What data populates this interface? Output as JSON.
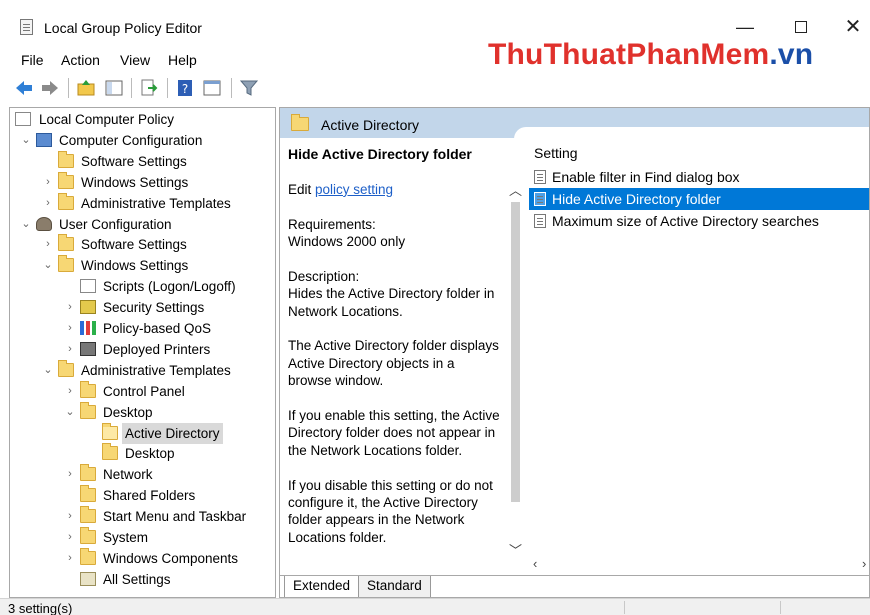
{
  "window": {
    "title": "Local Group Policy Editor",
    "min": "—",
    "close": "✕"
  },
  "watermark": {
    "part1": "ThuThuat",
    "part2": "PhanMem",
    "part3": ".vn"
  },
  "menu": [
    "File",
    "Action",
    "View",
    "Help"
  ],
  "toolbar": [
    "back-icon",
    "forward-icon",
    "up-folder-icon",
    "show-hide-tree-icon",
    "export-list-icon",
    "help-icon",
    "properties-icon",
    "filter-icon"
  ],
  "tree": [
    {
      "label": "Local Computer Policy",
      "level": 0,
      "chev": "",
      "icon": "doc"
    },
    {
      "label": "Computer Configuration",
      "level": 1,
      "chev": "⌄",
      "icon": "computer"
    },
    {
      "label": "Software Settings",
      "level": 2,
      "chev": "",
      "icon": "folder"
    },
    {
      "label": "Windows Settings",
      "level": 2,
      "chev": "›",
      "icon": "folder"
    },
    {
      "label": "Administrative Templates",
      "level": 2,
      "chev": "›",
      "icon": "folder"
    },
    {
      "label": "User Configuration",
      "level": 1,
      "chev": "⌄",
      "icon": "user"
    },
    {
      "label": "Software Settings",
      "level": 2,
      "chev": "›",
      "icon": "folder"
    },
    {
      "label": "Windows Settings",
      "level": 2,
      "chev": "⌄",
      "icon": "folder"
    },
    {
      "label": "Scripts (Logon/Logoff)",
      "level": 3,
      "chev": "",
      "icon": "doc"
    },
    {
      "label": "Security Settings",
      "level": 3,
      "chev": "›",
      "icon": "shield"
    },
    {
      "label": "Policy-based QoS",
      "level": 3,
      "chev": "›",
      "icon": "bars"
    },
    {
      "label": "Deployed Printers",
      "level": 3,
      "chev": "›",
      "icon": "printer"
    },
    {
      "label": "Administrative Templates",
      "level": 2,
      "chev": "⌄",
      "icon": "folder"
    },
    {
      "label": "Control Panel",
      "level": 3,
      "chev": "›",
      "icon": "folder"
    },
    {
      "label": "Desktop",
      "level": 3,
      "chev": "⌄",
      "icon": "folder"
    },
    {
      "label": "Active Directory",
      "level": 4,
      "chev": "",
      "icon": "folder-open",
      "selected": true
    },
    {
      "label": "Desktop",
      "level": 4,
      "chev": "",
      "icon": "folder"
    },
    {
      "label": "Network",
      "level": 3,
      "chev": "›",
      "icon": "folder"
    },
    {
      "label": "Shared Folders",
      "level": 3,
      "chev": "",
      "icon": "folder"
    },
    {
      "label": "Start Menu and Taskbar",
      "level": 3,
      "chev": "›",
      "icon": "folder"
    },
    {
      "label": "System",
      "level": 3,
      "chev": "›",
      "icon": "folder"
    },
    {
      "label": "Windows Components",
      "level": 3,
      "chev": "›",
      "icon": "folder"
    },
    {
      "label": "All Settings",
      "level": 3,
      "chev": "",
      "icon": "settings"
    }
  ],
  "pane": {
    "header": "Active Directory",
    "desc_title": "Hide Active Directory folder",
    "edit_prefix": "Edit ",
    "edit_link": "policy setting ",
    "requirements_label": "Requirements:",
    "requirements_value": "Windows 2000 only",
    "description_label": "Description:",
    "description_1": "Hides the Active Directory folder in Network Locations.",
    "description_2": "The Active Directory folder displays Active Directory objects in a browse window.",
    "description_3": "If you enable this setting, the Active Directory folder does not appear in the Network Locations folder.",
    "description_4": "If you disable this setting or do not configure it, the Active Directory folder appears in the Network Locations folder."
  },
  "list": {
    "column": "Setting",
    "rows": [
      {
        "label": "Enable filter in Find dialog box",
        "selected": false
      },
      {
        "label": "Hide Active Directory folder",
        "selected": true
      },
      {
        "label": "Maximum size of Active Directory searches",
        "selected": false
      }
    ]
  },
  "tabs": [
    "Extended",
    "Standard"
  ],
  "status": "3 setting(s)",
  "colors": {
    "selection": "#0078d7",
    "header": "#c2d6ea",
    "link": "#1d5fc8"
  }
}
